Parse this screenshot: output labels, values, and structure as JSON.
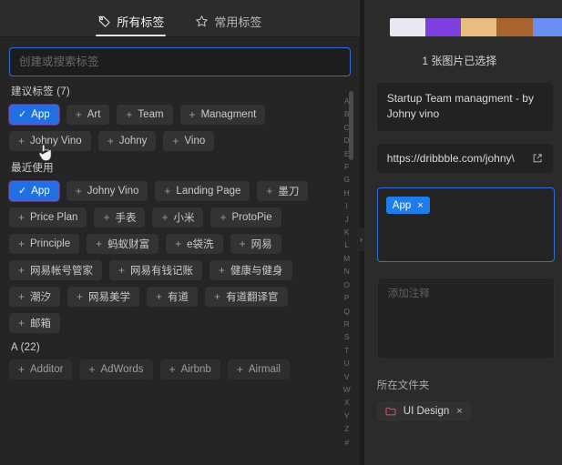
{
  "tabs": [
    {
      "label": "所有标签",
      "icon": "tag-icon",
      "active": true
    },
    {
      "label": "常用标签",
      "icon": "star-icon",
      "active": false
    }
  ],
  "search": {
    "placeholder": "创建或搜索标签",
    "value": ""
  },
  "sections": [
    {
      "title": "建议标签 (7)",
      "tags": [
        {
          "label": "App",
          "selected": true
        },
        {
          "label": "Art",
          "selected": false
        },
        {
          "label": "Team",
          "selected": false
        },
        {
          "label": "Managment",
          "selected": false
        },
        {
          "label": "Johny Vino",
          "selected": false
        },
        {
          "label": "Johny",
          "selected": false
        },
        {
          "label": "Vino",
          "selected": false
        }
      ]
    },
    {
      "title": "最近使用",
      "tags": [
        {
          "label": "App",
          "selected": true
        },
        {
          "label": "Johny Vino",
          "selected": false
        },
        {
          "label": "Landing Page",
          "selected": false
        },
        {
          "label": "墨刀",
          "selected": false
        },
        {
          "label": "Price Plan",
          "selected": false
        },
        {
          "label": "手表",
          "selected": false
        },
        {
          "label": "小米",
          "selected": false
        },
        {
          "label": "ProtoPie",
          "selected": false
        },
        {
          "label": "Principle",
          "selected": false
        },
        {
          "label": "蚂蚁财富",
          "selected": false
        },
        {
          "label": "e袋洗",
          "selected": false
        },
        {
          "label": "网易",
          "selected": false
        },
        {
          "label": "网易帐号管家",
          "selected": false
        },
        {
          "label": "网易有钱记账",
          "selected": false
        },
        {
          "label": "健康与健身",
          "selected": false
        },
        {
          "label": "潮汐",
          "selected": false
        },
        {
          "label": "网易美学",
          "selected": false
        },
        {
          "label": "有道",
          "selected": false
        },
        {
          "label": "有道翻译官",
          "selected": false
        },
        {
          "label": "邮箱",
          "selected": false
        }
      ]
    },
    {
      "title": "A (22)",
      "tags": [
        {
          "label": "Additor",
          "selected": false
        },
        {
          "label": "AdWords",
          "selected": false
        },
        {
          "label": "Airbnb",
          "selected": false
        },
        {
          "label": "Airmail",
          "selected": false
        }
      ]
    }
  ],
  "alpha_index": [
    "A",
    "B",
    "C",
    "D",
    "E",
    "F",
    "G",
    "H",
    "I",
    "J",
    "K",
    "L",
    "M",
    "N",
    "O",
    "P",
    "Q",
    "R",
    "S",
    "T",
    "U",
    "V",
    "W",
    "X",
    "Y",
    "Z",
    "#"
  ],
  "right": {
    "palette": [
      "#e9e7f1",
      "#7d3fe0",
      "#e8bd80",
      "#a9632c",
      "#6b8ef5"
    ],
    "selection_count_label": "1 张图片已选择",
    "item_title": "Startup Team managment - by Johny vino",
    "item_url": "https://dribbble.com/johny\\",
    "external_link_icon": "external-link-icon",
    "applied_tags": [
      {
        "label": "App",
        "remove": "×"
      }
    ],
    "note_placeholder": "添加注释",
    "note_value": "",
    "folder_label": "所在文件夹",
    "folders": [
      {
        "label": "UI Design",
        "color": "#c9515d",
        "remove": "×"
      }
    ]
  },
  "colors": {
    "accent_blue": "#1f7ced",
    "focus_border": "#2f6fd0",
    "chip_bg": "#333333",
    "left_bg": "#252525",
    "right_bg": "#2b2b2b"
  }
}
